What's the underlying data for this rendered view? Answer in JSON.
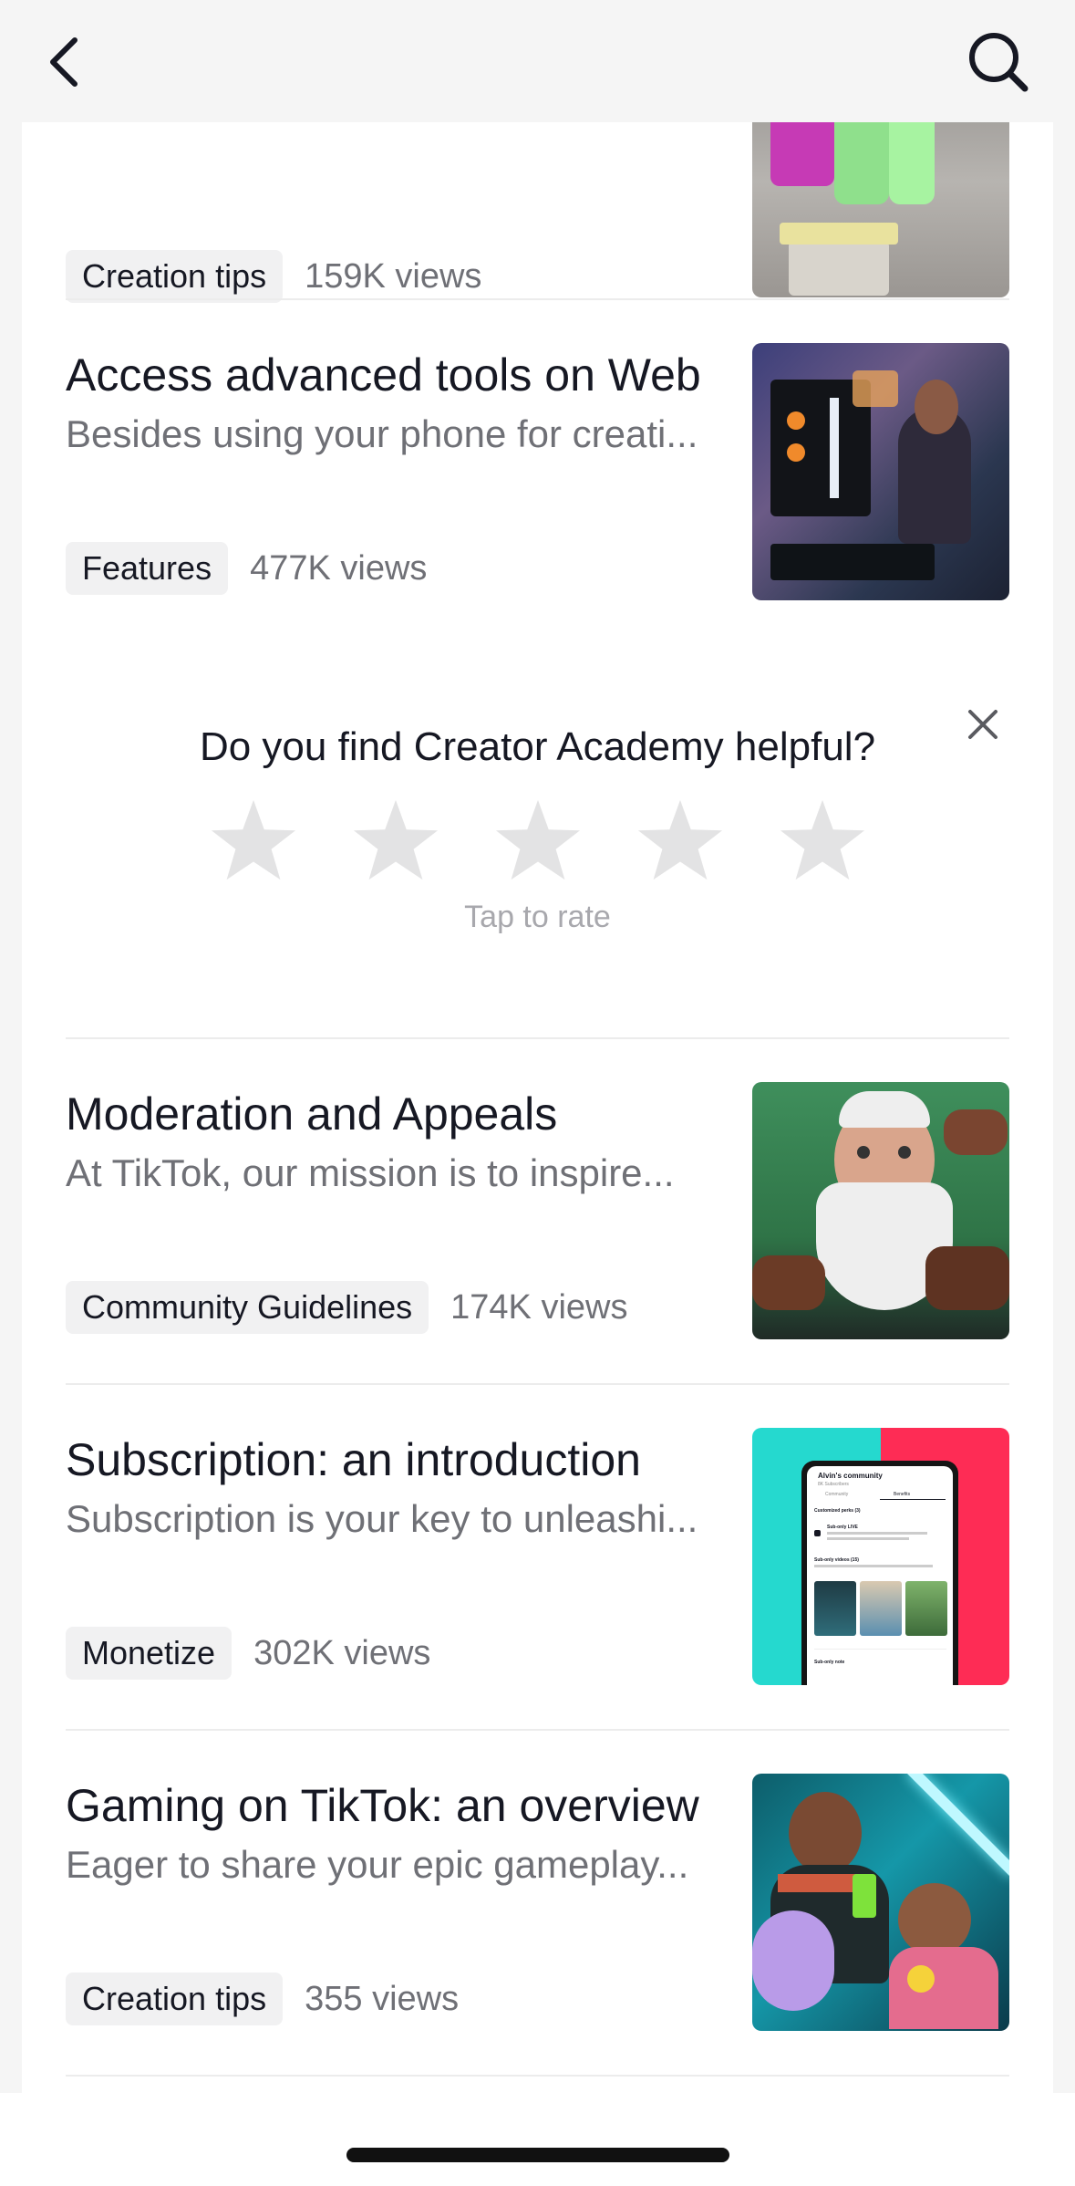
{
  "nav": {
    "back_icon": "chevron-left-icon",
    "search_icon": "search-icon"
  },
  "articles": [
    {
      "title": "",
      "description": "",
      "tag": "Creation tips",
      "views": "159K views",
      "thumb": "dancer-thumbnail"
    },
    {
      "title": "Access advanced tools on Web",
      "description": "Besides using your phone for creati...",
      "tag": "Features",
      "views": "477K views",
      "thumb": "desk-computer-thumbnail"
    },
    {
      "title": "Moderation and Appeals",
      "description": "At TikTok, our mission is to inspire...",
      "tag": "Community Guidelines",
      "views": "174K views",
      "thumb": "bearded-man-thumbnail"
    },
    {
      "title": "Subscription: an introduction",
      "description": "Subscription is your key to unleashi...",
      "tag": "Monetize",
      "views": "302K views",
      "thumb": "phone-mockup-thumbnail"
    },
    {
      "title": "Gaming on TikTok: an overview",
      "description": "Eager to share your epic gameplay...",
      "tag": "Creation tips",
      "views": "355 views",
      "thumb": "gamers-thumbnail"
    }
  ],
  "rating": {
    "question": "Do you find Creator Academy helpful?",
    "hint": "Tap to rate",
    "star_count": 5,
    "selected": 0,
    "close_icon": "close-icon"
  },
  "phone_mockup": {
    "community_title": "Alvin's community",
    "subscribers": "8K Subscribers",
    "tab_1": "Community",
    "tab_2": "Benefits",
    "section_1": "Customized perks (3)",
    "perk_1": "Sub-only LIVE",
    "section_2": "Sub-only videos (15)",
    "section_3": "Sub-only note"
  },
  "colors": {
    "tag_bg": "#f1f1f2",
    "star": "#e3e3e4",
    "tiktok_teal": "#25d9cf",
    "tiktok_pink": "#fe2c55"
  }
}
